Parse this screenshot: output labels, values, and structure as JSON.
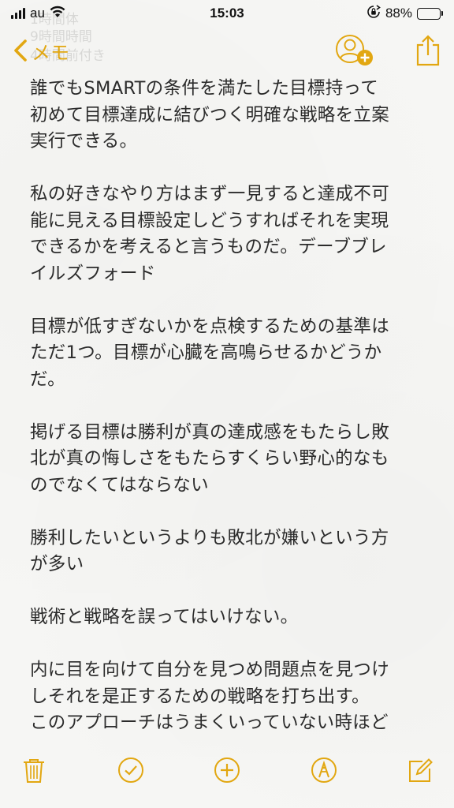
{
  "status_bar": {
    "carrier": "au",
    "time": "15:03",
    "battery_percent": "88%",
    "battery_level": 0.88,
    "icons": [
      "signal-bars-icon",
      "wifi-icon",
      "rotation-lock-icon",
      "battery-icon"
    ]
  },
  "nav": {
    "back_label": "メモ",
    "ghost_lines": [
      "1時間体",
      "9時間時間",
      "4時間前付き"
    ],
    "icons": [
      "chevron-left-icon",
      "add-person-icon",
      "share-icon"
    ]
  },
  "note": {
    "paragraphs": [
      "誰でもSMARTの条件を満たした目標持って\n初めて目標達成に結びつく明確な戦略を立案\n実行できる。",
      "私の好きなやり方はまず一見すると達成不可\n能に見える目標設定しどうすればそれを実現\nできるかを考えると言うものだ。デーブブレ\nイルズフォード",
      "目標が低すぎないかを点検するための基準は\nただ1つ。目標が心臓を高鳴らせるかどうか\nだ。",
      "掲げる目標は勝利が真の達成感をもたらし敗\n北が真の悔しさをもたらすくらい野心的なも\nのでなくてはならない",
      "勝利したいというよりも敗北が嫌いという方\nが多い",
      "戦術と戦略を誤ってはいけない。",
      "内に目を向けて自分を見つめ問題点を見つけ\nしそれを是正するための戦略を打ち出す。\nこのアプローチはうまくいっていない時ほど"
    ]
  },
  "toolbar": {
    "icons": [
      "trash-icon",
      "checklist-icon",
      "add-icon",
      "markup-pen-icon",
      "compose-icon"
    ]
  },
  "colors": {
    "accent": "#e2a711",
    "text": "#2b2b2b",
    "background": "#f6f6f4"
  }
}
